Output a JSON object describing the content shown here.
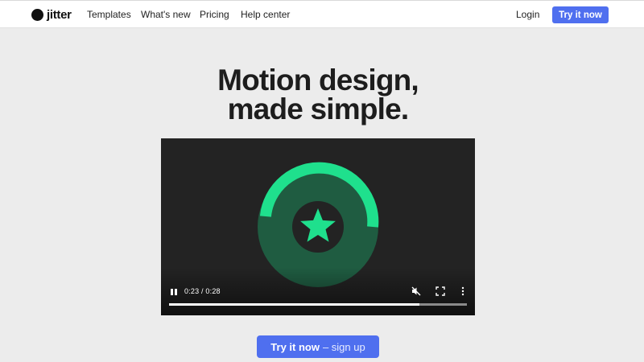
{
  "nav": {
    "brand": "jitter",
    "links": [
      "Templates",
      "What's new",
      "Pricing",
      "Help center"
    ],
    "login": "Login",
    "cta": "Try it now"
  },
  "hero": {
    "title_line1": "Motion design,",
    "title_line2": "made simple."
  },
  "video": {
    "time": "0:23 / 0:28",
    "progress": 0.84,
    "icons": [
      "pause-icon",
      "mute-icon",
      "fullscreen-icon",
      "more-options-icon"
    ],
    "accent": "#1fe08d",
    "disc_color": "#1f5c41"
  },
  "signup": {
    "bold": "Try it now",
    "rest": "– sign up"
  },
  "colors": {
    "brand_blue": "#4f6fef",
    "background": "#ececec"
  }
}
